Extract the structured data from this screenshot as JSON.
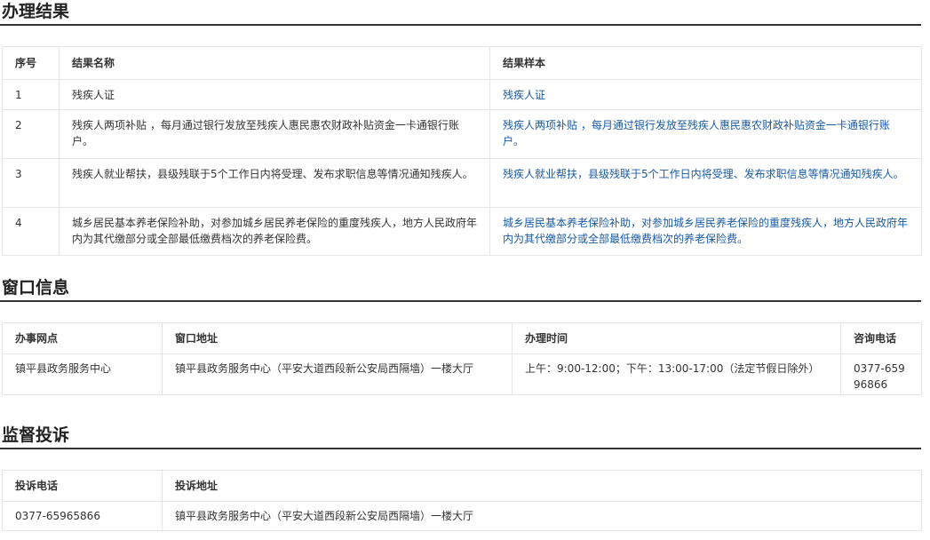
{
  "result": {
    "title": "办理结果",
    "headers": [
      "序号",
      "结果名称",
      "结果样本"
    ],
    "rows": [
      {
        "no": "1",
        "name": "残疾人证",
        "sample": "残疾人证"
      },
      {
        "no": "2",
        "name": "残疾人两项补贴 ，每月通过银行发放至残疾人惠民惠农财政补贴资金一卡通银行账户。",
        "sample": "残疾人两项补贴 ，每月通过银行发放至残疾人惠民惠农财政补贴资金一卡通银行账户。"
      },
      {
        "no": "3",
        "name": "残疾人就业帮扶，县级残联于5个工作日内将受理、发布求职信息等情况通知残疾人。",
        "sample": "残疾人就业帮扶，县级残联于5个工作日内将受理、发布求职信息等情况通知残疾人。"
      },
      {
        "no": "4",
        "name": "城乡居民基本养老保险补助，对参加城乡居民养老保险的重度残疾人，地方人民政府年内为其代缴部分或全部最低缴费档次的养老保险费。",
        "sample": "城乡居民基本养老保险补助，对参加城乡居民养老保险的重度残疾人，地方人民政府年内为其代缴部分或全部最低缴费档次的养老保险费。"
      }
    ]
  },
  "window": {
    "title": "窗口信息",
    "headers": [
      "办事网点",
      "窗口地址",
      "办理时间",
      "咨询电话"
    ],
    "row": {
      "office": "镇平县政务服务中心",
      "address": "镇平县政务服务中心（平安大道西段新公安局西隔墙）一楼大厅",
      "hours": "上午：9:00-12:00；下午：13:00-17:00（法定节假日除外）",
      "phone": "0377-65996866"
    }
  },
  "complaint": {
    "title": "监督投诉",
    "headers": [
      "投诉电话",
      "投诉地址"
    ],
    "row": {
      "phone": "0377-65965866",
      "address": "镇平县政务服务中心（平安大道西段新公安局西隔墙）一楼大厅"
    }
  },
  "colors": {
    "link": "#1a5aa3",
    "border": "#e5e5e5",
    "title_rule": "#333333"
  }
}
